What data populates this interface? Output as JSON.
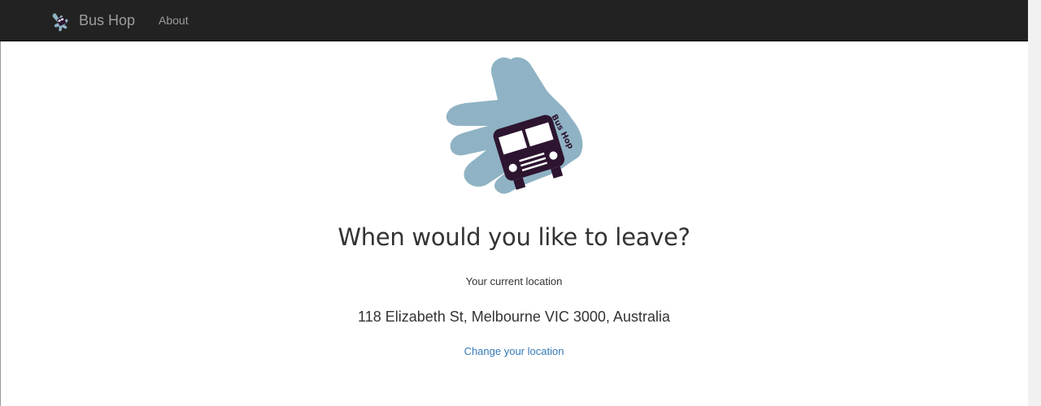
{
  "navbar": {
    "brand_text": "Bus Hop",
    "brand_icon": "bus-hop-hand-icon",
    "links": [
      {
        "label": "About"
      }
    ]
  },
  "main": {
    "logo": {
      "icon": "bus-hop-hand-logo",
      "text": "Bus Hop"
    },
    "heading": "When would you like to leave?",
    "location_label": "Your current location",
    "address": "118 Elizabeth St, Melbourne VIC 3000, Australia",
    "change_location_link": "Change your location"
  },
  "colors": {
    "navbar_bg": "#222222",
    "nav_text": "#9d9d9d",
    "hand": "#8fb3c4",
    "bus": "#2d1530",
    "link": "#337ab7",
    "text": "#333333"
  }
}
